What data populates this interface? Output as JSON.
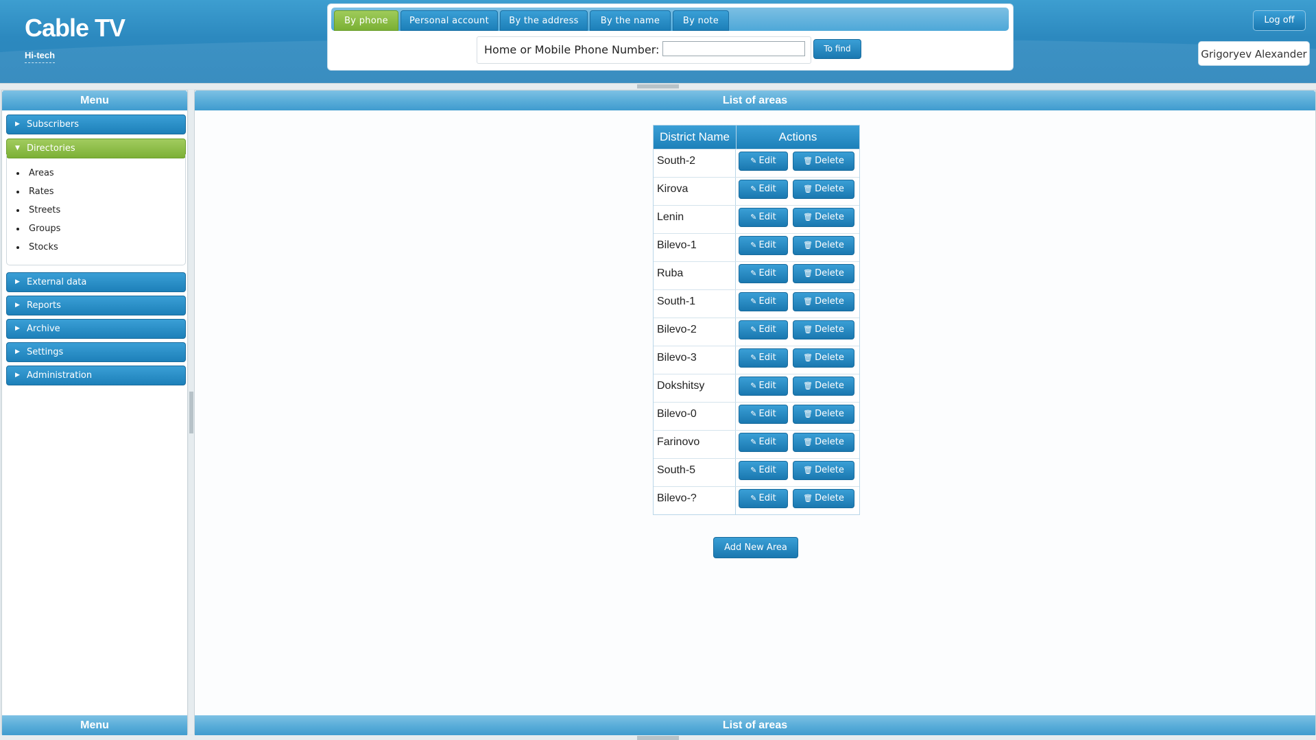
{
  "app": {
    "title": "Cable TV",
    "subtitle": "Hi-tech"
  },
  "search": {
    "tabs": [
      {
        "label": "By phone",
        "active": true
      },
      {
        "label": "Personal account",
        "active": false
      },
      {
        "label": "By the address",
        "active": false
      },
      {
        "label": "By the name",
        "active": false
      },
      {
        "label": "By note",
        "active": false
      }
    ],
    "field_label": "Home or Mobile Phone Number:",
    "field_value": "",
    "find_label": "To find"
  },
  "user": {
    "name": "Grigoryev Alexander",
    "logoff_label": "Log off"
  },
  "menu": {
    "title": "Menu",
    "items": [
      {
        "label": "Subscribers"
      },
      {
        "label": "Directories",
        "expanded": true
      },
      {
        "label": "External data"
      },
      {
        "label": "Reports"
      },
      {
        "label": "Archive"
      },
      {
        "label": "Settings"
      },
      {
        "label": "Administration"
      }
    ],
    "directories": [
      "Areas",
      "Rates",
      "Streets",
      "Groups",
      "Stocks"
    ]
  },
  "main": {
    "title": "List of areas",
    "table": {
      "headers": [
        "District Name",
        "Actions"
      ],
      "edit_label": "Edit",
      "delete_label": "Delete",
      "rows": [
        "South-2",
        "Kirova",
        "Lenin",
        "Bilevo-1",
        "Ruba",
        "South-1",
        "Bilevo-2",
        "Bilevo-3",
        "Dokshitsy",
        "Bilevo-0",
        "Farinovo",
        "South-5",
        "Bilevo-?"
      ]
    },
    "add_label": "Add New Area"
  },
  "colors": {
    "accent": "#2a8ac3",
    "active": "#8bbf45"
  }
}
